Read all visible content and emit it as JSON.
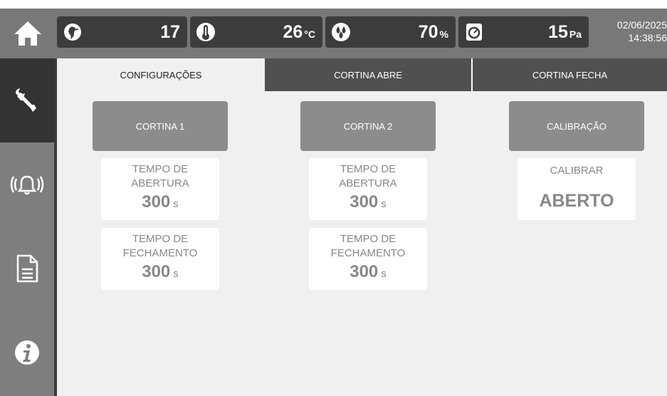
{
  "header": {
    "stats": [
      {
        "icon": "bird-icon",
        "value": "17",
        "unit": ""
      },
      {
        "icon": "thermometer-icon",
        "value": "26",
        "unit": "°C"
      },
      {
        "icon": "humidity-drops-icon",
        "value": "70",
        "unit": "%"
      },
      {
        "icon": "pressure-gauge-icon",
        "value": "15",
        "unit": "Pa"
      }
    ],
    "date": "02/06/2025",
    "time": "14:38:56"
  },
  "sidebar": {
    "items": [
      {
        "icon": "wrench-icon",
        "active": true
      },
      {
        "icon": "alarm-bell-icon",
        "active": false
      },
      {
        "icon": "document-icon",
        "active": false
      },
      {
        "icon": "info-icon",
        "active": false
      }
    ]
  },
  "tabs": [
    {
      "label": "CONFIGURAÇÕES",
      "active": true
    },
    {
      "label": "CORTINA ABRE",
      "active": false
    },
    {
      "label": "CORTINA FECHA",
      "active": false
    }
  ],
  "columns": [
    {
      "button": "CORTINA 1",
      "cards": [
        {
          "label_line1": "TEMPO DE",
          "label_line2": "ABERTURA",
          "value": "300",
          "unit": "s"
        },
        {
          "label_line1": "TEMPO DE",
          "label_line2": "FECHAMENTO",
          "value": "300",
          "unit": "s"
        }
      ]
    },
    {
      "button": "CORTINA 2",
      "cards": [
        {
          "label_line1": "TEMPO DE",
          "label_line2": "ABERTURA",
          "value": "300",
          "unit": "s"
        },
        {
          "label_line1": "TEMPO DE",
          "label_line2": "FECHAMENTO",
          "value": "300",
          "unit": "s"
        }
      ]
    },
    {
      "button": "CALIBRAÇÃO",
      "cards": [
        {
          "label_line1": "CALIBRAR",
          "value": "ABERTO"
        }
      ]
    }
  ],
  "colors": {
    "topbar": "#787878",
    "stat_bg": "#3c3c3c",
    "sidebar": "#7e7e7e",
    "sidebar_active": "#333333",
    "tab_inactive": "#505050",
    "content_bg": "#f0f0f0",
    "section_button": "#8c8c8c"
  }
}
